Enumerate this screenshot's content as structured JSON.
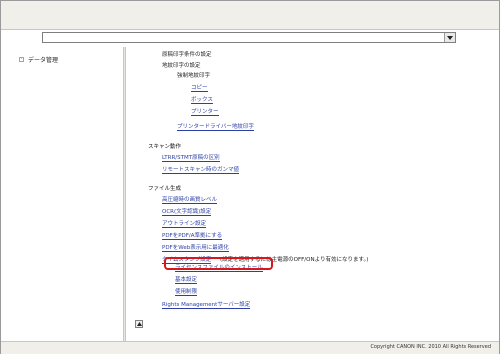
{
  "nav": {
    "tree_item_label": "データ管理"
  },
  "address_bar": {
    "value": ""
  },
  "content": {
    "lines": [
      "原稿印字条件の設定",
      "地紋印字の設定",
      "強制地紋印字",
      "コピー",
      "ボックス",
      "プリンター",
      "プリンタードライバー地紋印字",
      "スキャン動作",
      "LTRR/STMT原稿の区別",
      "リモートスキャン時のガンマ値",
      "ファイル生成",
      "高圧縮時の画質レベル",
      "OCR(文字認識)設定",
      "アウトライン設定",
      "PDFをPDF/A準拠にする",
      "PDFをWeb表示用に最適化",
      "タイムスタンプ設定",
      "(設定を適用するには主電源のOFF/ONより有効になります。)",
      "ライセンスファイルのインストール",
      "基本設定",
      "使用制限",
      "Rights Managementサーバー設定"
    ]
  },
  "footer": {
    "copyright": "Copyright CANON INC. 2010 All Rights Reserved"
  }
}
